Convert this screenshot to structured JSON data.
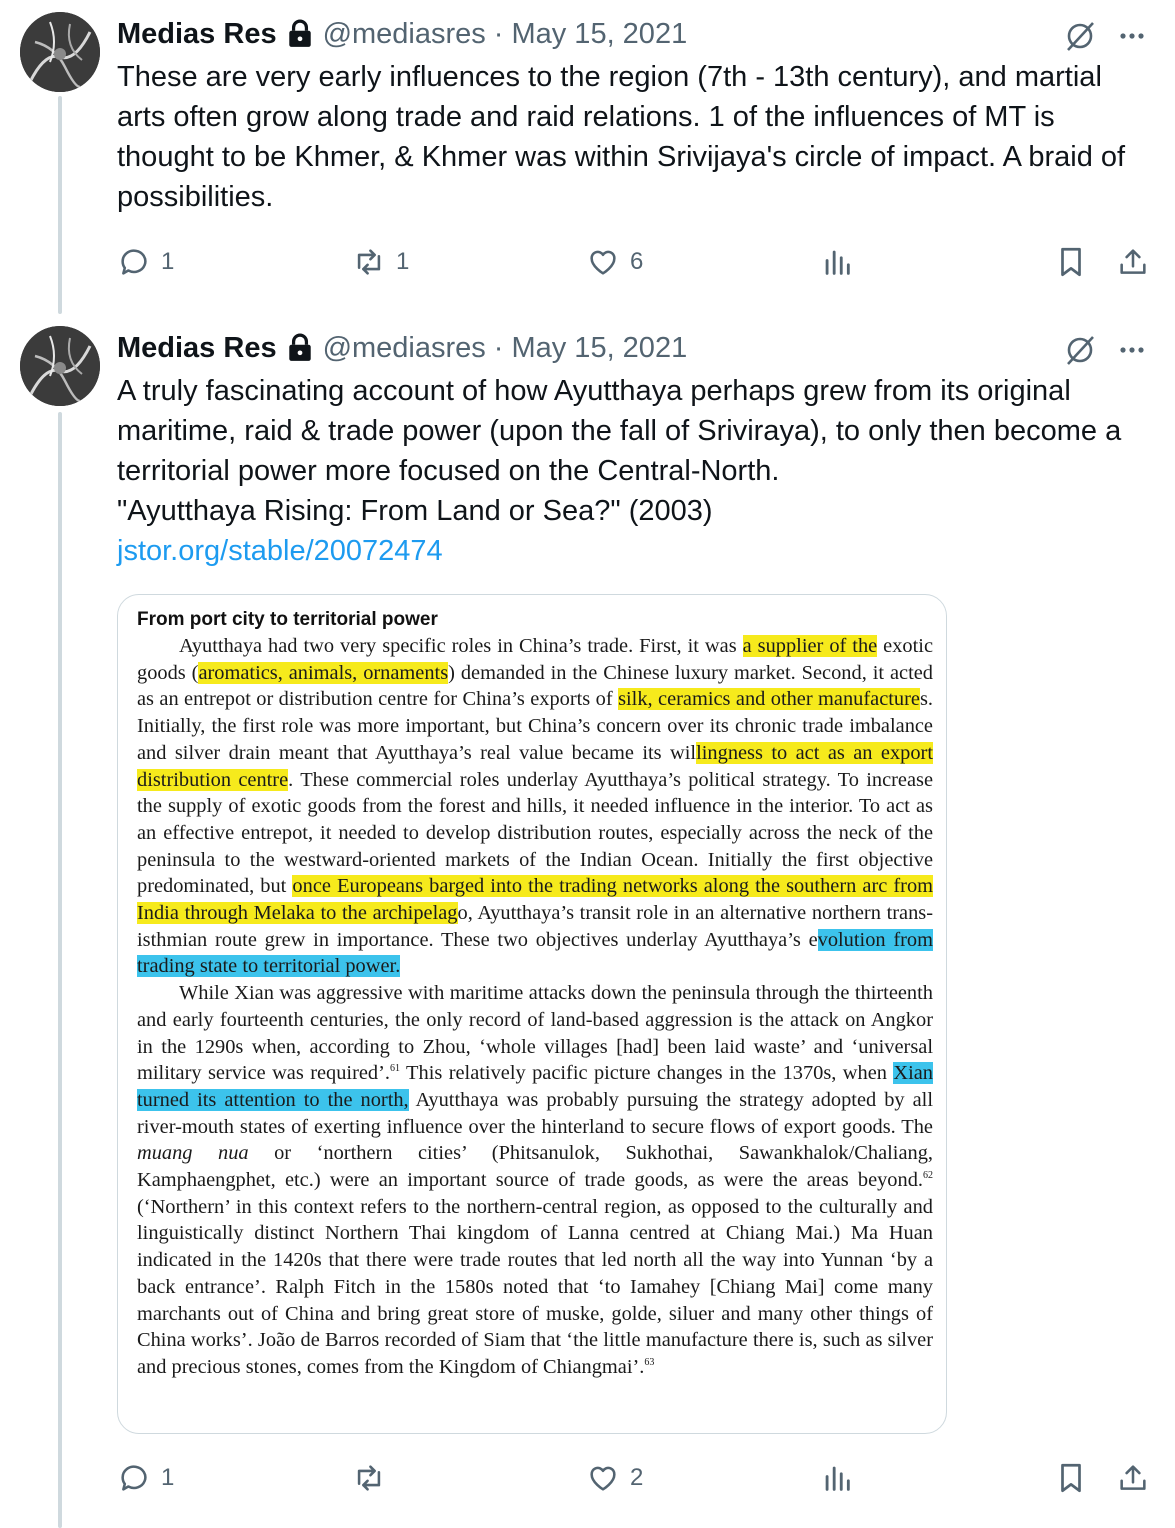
{
  "tweets": [
    {
      "author": "Medias Res",
      "handle": "@mediasres",
      "separator": "·",
      "date": "May 15, 2021",
      "text": "These are very early influences to the region (7th - 13th century), and martial arts often grow along trade and raid relations. 1 of the influences of MT is thought to be Khmer, & Khmer was within Srivijaya's circle of impact. A braid of possibilities.",
      "replies": "1",
      "reposts": "1",
      "likes": "6"
    },
    {
      "author": "Medias Res",
      "handle": "@mediasres",
      "separator": "·",
      "date": "May 15, 2021",
      "text_line1": "A truly fascinating account of how Ayutthaya perhaps grew from its original maritime, raid & trade power (upon the fall of Sriviraya), to only then become a territorial power more focused on the Central-North.",
      "text_line2": "\"Ayutthaya Rising: From Land or Sea?\" (2003)",
      "link": "jstor.org/stable/20072474",
      "replies": "1",
      "reposts": "",
      "likes": "2",
      "image": {
        "heading": "From port city to territorial power",
        "p1": {
          "a": "Ayutthaya had two very specific roles in China’s trade. First, it was ",
          "h1": "a supplier of the",
          "b": " exotic goods (",
          "h2": "aromatics, animals, ornaments",
          "c": ") demanded in the Chinese luxury market. Second, it acted as an entrepot or distribution centre for China’s exports of ",
          "h3": "silk, ceramics and other manufacture",
          "d": "s. Initially, the first role was more important, but China’s concern over its chronic trade imbalance and silver drain meant that Ayutthaya’s real value became its wil",
          "h4": "lingness to act as an export distribution centre",
          "e": ". These commercial roles underlay Ayutthaya’s political strategy. To increase the supply of exotic goods from the forest and hills, it needed influence in the interior. To act as an effective entrepot, it needed to develop distribution routes, especially across the neck of the peninsula to the westward-oriented markets of the Indian Ocean. Initially the first objective predominated, but ",
          "h5": "once Europeans barged into the trading networks along the southern arc from India through Melaka to the archipelag",
          "f": "o, Ayutthaya’s transit role in an alternative northern trans-isthmian route grew in importance. These two objectives underlay Ayutthaya’s e",
          "h6": "volution from trading state to territorial power."
        },
        "p2": {
          "a": "While Xian was aggressive with maritime attacks down the peninsula through the thirteenth and early fourteenth centuries, the only record of land-based aggression is the attack on Angkor in the 1290s when, according to Zhou, ‘whole villages [had] been laid waste’ and ‘universal military service was required’.",
          "fn1": "61",
          "b": " This relatively pacific picture changes in the 1370s, when ",
          "h1": "Xian turned its attention to the north,",
          "c": " Ayutthaya was probably pursuing the strategy adopted by all river-mouth states of exerting influence over the hinterland to secure flows of export goods. The ",
          "em": "muang nua",
          "d": " or ‘northern cities’ (Phitsanulok, Sukhothai, Sawankhalok/Chaliang, Kamphaengphet, etc.) were an important source of trade goods, as were the areas beyond.",
          "fn2": "62",
          "e": " (‘Northern’ in this context refers to the northern-central region, as opposed to the culturally and linguistically distinct Northern Thai kingdom of Lanna centred at Chiang Mai.) Ma Huan indicated in the 1420s that there were trade routes that led north all the way into Yunnan ‘by a back entrance’. Ralph Fitch in the 1580s noted that ‘to Iamahey [Chiang Mai] come many marchants out of China and bring great store of muske, golde, siluer and many other things of China works’. João de Barros recorded of Siam that ‘the little manufacture there is, such as silver and precious stones, comes from the Kingdom of Chiangmai’.",
          "fn3": "63"
        }
      }
    }
  ],
  "colors": {
    "text": "#0f1419",
    "secondary": "#536471",
    "link": "#1d9bf0",
    "thread_line": "#cfd9de",
    "highlight_yellow": "#f6ea1c",
    "highlight_blue": "#3cc3ec"
  },
  "icons": [
    "lock-icon",
    "grok-icon",
    "more-icon",
    "reply-icon",
    "repost-icon",
    "like-icon",
    "views-icon",
    "bookmark-icon",
    "share-icon"
  ]
}
